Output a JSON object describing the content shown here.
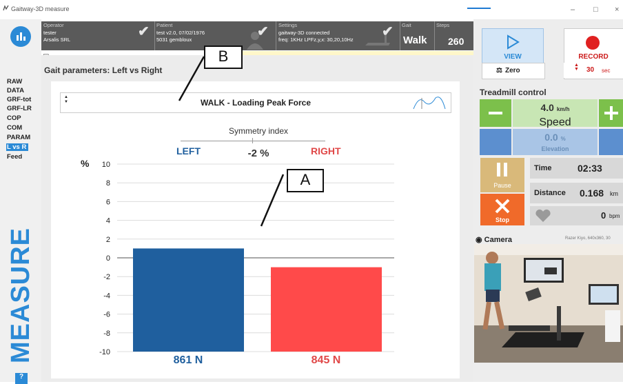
{
  "window": {
    "title": "Gaitway-3D measure"
  },
  "sidebar": {
    "items": [
      {
        "label": "RAW"
      },
      {
        "label": "DATA"
      },
      {
        "label": "GRF-tot"
      },
      {
        "label": "GRF-LR"
      },
      {
        "label": "COP"
      },
      {
        "label": "COM"
      },
      {
        "label": "PARAM"
      },
      {
        "label": "L vs R"
      },
      {
        "label": "Feed"
      }
    ],
    "active_index": 7,
    "vertical_label": "MEASURE",
    "help_label": "?"
  },
  "status": {
    "operator": {
      "label": "Operator",
      "line1": "tester",
      "line2": "Arsalis SRL"
    },
    "patient": {
      "label": "Patient",
      "line1": "test v2.0, 07/02/1976",
      "line2": "5031 gembloux"
    },
    "settings": {
      "label": "Settings",
      "line1": "gaitway-3D connected",
      "line2": "freq: 1KHz  LPFz,y,x: 30,20,10Hz"
    },
    "gait": {
      "label": "Gait",
      "value": "Walk"
    },
    "steps": {
      "label": "Steps",
      "value": "260"
    }
  },
  "main": {
    "heading": "Gait parameters: Left vs Right",
    "selector": "WALK - Loading Peak Force",
    "symmetry": {
      "title": "Symmetry index",
      "left_label": "LEFT",
      "right_label": "RIGHT",
      "value": "-2 %"
    },
    "left_force": "861 N",
    "right_force": "845 N"
  },
  "chart_data": {
    "type": "bar",
    "categories": [
      "LEFT",
      "RIGHT"
    ],
    "values": [
      1,
      -1
    ],
    "colors": [
      "#1f5f9e",
      "#ff4a4a"
    ],
    "ylabel": "%",
    "ylim": [
      -10,
      10
    ],
    "yticks": [
      10,
      8,
      6,
      4,
      2,
      0,
      -2,
      -4,
      -6,
      -8,
      -10
    ],
    "grid": true
  },
  "annotations": {
    "a": "A",
    "b": "B"
  },
  "control": {
    "view_label": "VIEW",
    "zero_label": "Zero",
    "record_label": "RECORD",
    "record_time": "30",
    "record_unit": "sec",
    "treadmill_title": "Treadmill control",
    "speed_value": "4.0",
    "speed_unit": "km/h",
    "speed_label": "Speed",
    "elevation_value": "0.0",
    "elevation_unit": "%",
    "elevation_label": "Elevation",
    "pause_label": "Pause",
    "stop_label": "Stop",
    "time_label": "Time",
    "time_value": "02:33",
    "distance_label": "Distance",
    "distance_value": "0.168",
    "distance_unit": "km",
    "bpm_value": "0",
    "bpm_unit": "bpm",
    "camera_label": "Camera",
    "camera_info": "Razer Kiyo, 640x360, 30"
  },
  "colors": {
    "accent": "#2b8ad6",
    "left": "#1f5f9e",
    "right": "#ff4a4a",
    "record": "#e02020",
    "green": "#7cc04b"
  }
}
